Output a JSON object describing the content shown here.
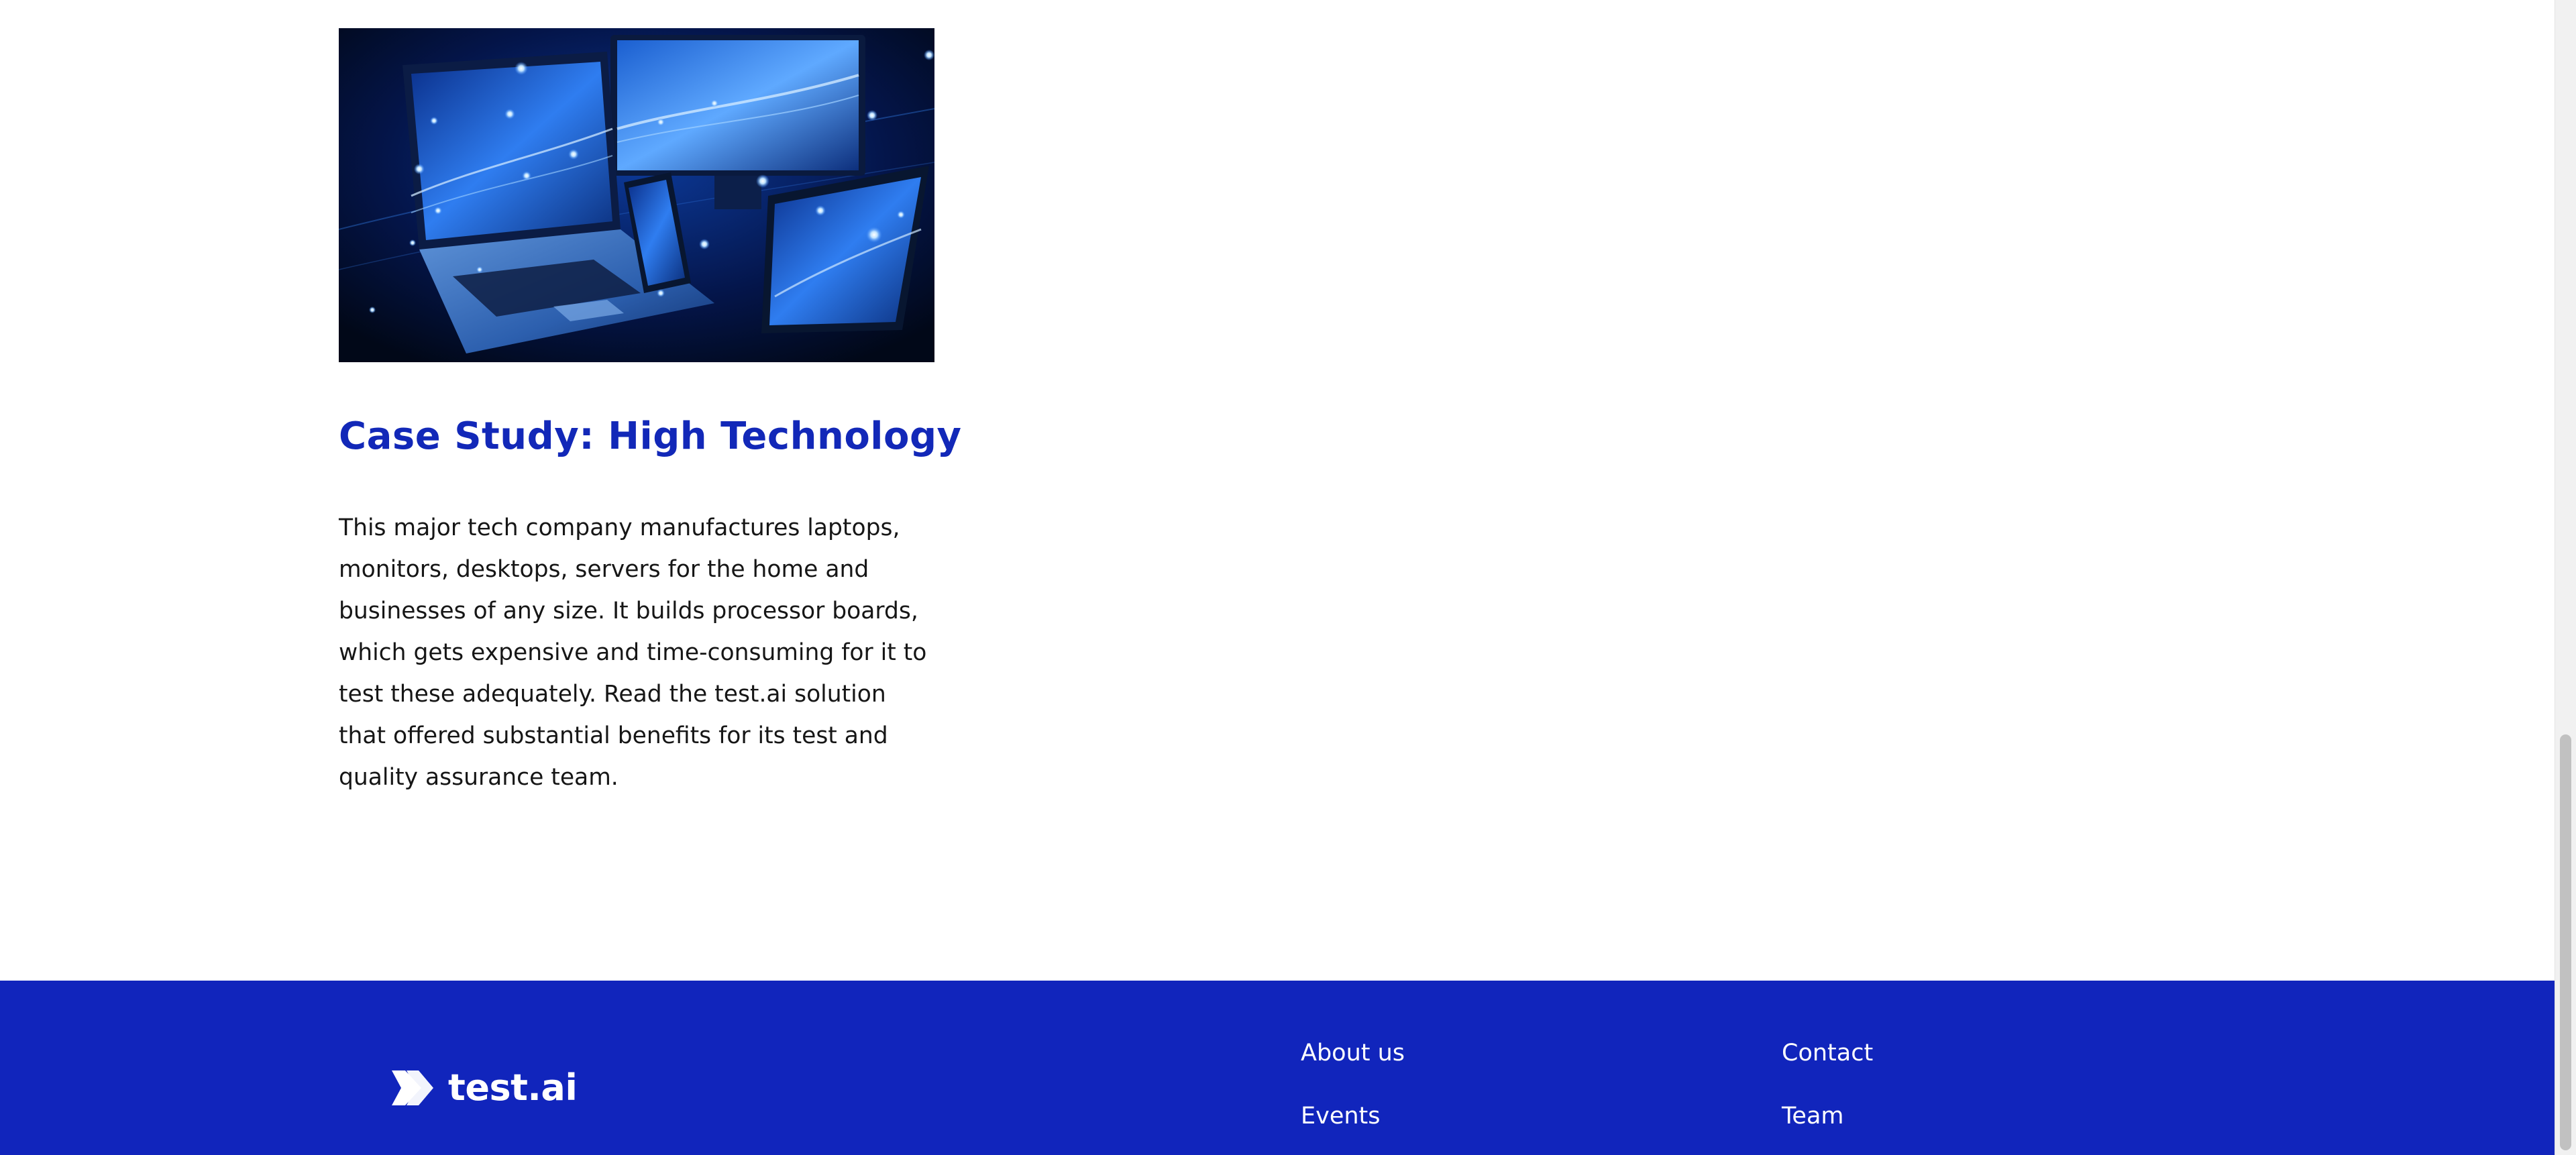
{
  "case_study": {
    "image_alt": "Laptop, tablet, phone and monitor with glowing blue screens",
    "title": "Case Study: High Technology",
    "description": "This major tech company manufactures laptops, monitors, desktops, servers for the home and businesses of any size. It builds processor boards, which gets expensive and time-consuming for it to test these adequately. Read the test.ai solution that offered substantial benefits for its test and quality assurance team."
  },
  "footer": {
    "logo_text": "test.ai",
    "links": {
      "about": "About us",
      "events": "Events",
      "contact": "Contact",
      "team": "Team"
    }
  },
  "colors": {
    "brand_blue": "#1125bc",
    "title_blue": "#1228b8",
    "text": "#161616",
    "white": "#ffffff"
  }
}
